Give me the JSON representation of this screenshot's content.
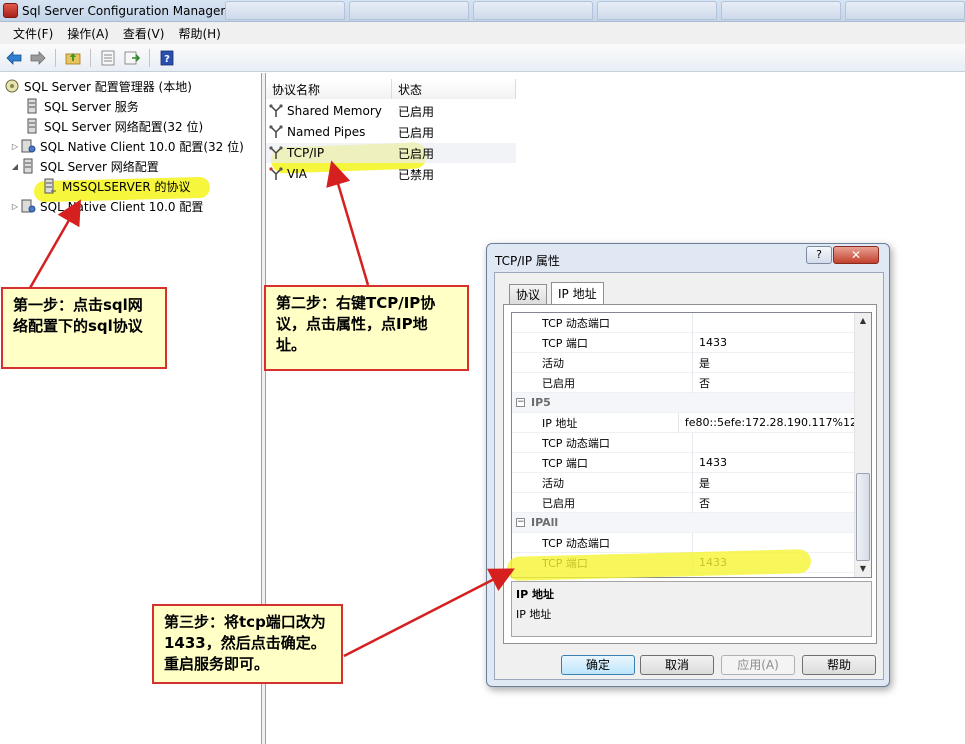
{
  "window": {
    "title": "Sql Server Configuration Manager"
  },
  "menu": {
    "items": [
      "文件(F)",
      "操作(A)",
      "查看(V)",
      "帮助(H)"
    ]
  },
  "toolbar": {
    "icons": [
      "back-icon",
      "forward-icon",
      "up-folder-icon",
      "properties-icon",
      "export-icon",
      "help-icon"
    ]
  },
  "tree": {
    "root": "SQL Server 配置管理器 (本地)",
    "items": [
      "SQL Server 服务",
      "SQL Server 网络配置(32 位)",
      "SQL Native Client 10.0 配置(32 位)",
      "SQL Server 网络配置",
      "MSSQLSERVER 的协议",
      "SQL Native Client 10.0 配置"
    ]
  },
  "protocols": {
    "col_name": "协议名称",
    "col_status": "状态",
    "rows": [
      {
        "name": "Shared Memory",
        "status": "已启用"
      },
      {
        "name": "Named Pipes",
        "status": "已启用"
      },
      {
        "name": "TCP/IP",
        "status": "已启用"
      },
      {
        "name": "VIA",
        "status": "已禁用"
      }
    ]
  },
  "annotations": {
    "step1": "第一步：点击sql网络配置下的sql协议",
    "step2": "第二步：右键TCP/IP协议，点击属性，点IP地址。",
    "step3": "第三步：将tcp端口改为1433，然后点击确定。重启服务即可。"
  },
  "colors": {
    "highlight": "#f5f532",
    "arrow": "#d62020",
    "callout_bg": "#ffffc6"
  },
  "dialog": {
    "title": "TCP/IP 属性",
    "help_btn": "?",
    "close_btn": "✕",
    "tabs": [
      "协议",
      "IP 地址"
    ],
    "active_tab": "IP 地址",
    "grid": [
      {
        "type": "prop",
        "key": "TCP 动态端口",
        "value": ""
      },
      {
        "type": "prop",
        "key": "TCP 端口",
        "value": "1433"
      },
      {
        "type": "prop",
        "key": "活动",
        "value": "是"
      },
      {
        "type": "prop",
        "key": "已启用",
        "value": "否"
      },
      {
        "type": "cat",
        "key": "IP5",
        "value": ""
      },
      {
        "type": "prop",
        "key": "IP 地址",
        "value": "fe80::5efe:172.28.190.117%12"
      },
      {
        "type": "prop",
        "key": "TCP 动态端口",
        "value": ""
      },
      {
        "type": "prop",
        "key": "TCP 端口",
        "value": "1433"
      },
      {
        "type": "prop",
        "key": "活动",
        "value": "是"
      },
      {
        "type": "prop",
        "key": "已启用",
        "value": "否"
      },
      {
        "type": "cat",
        "key": "IPAll",
        "value": ""
      },
      {
        "type": "prop",
        "key": "TCP 动态端口",
        "value": ""
      },
      {
        "type": "prop",
        "key": "TCP 端口",
        "value": "1433"
      }
    ],
    "desc_title": "IP 地址",
    "desc_text": "IP 地址",
    "buttons": {
      "ok": "确定",
      "cancel": "取消",
      "apply": "应用(A)",
      "help": "帮助"
    }
  }
}
